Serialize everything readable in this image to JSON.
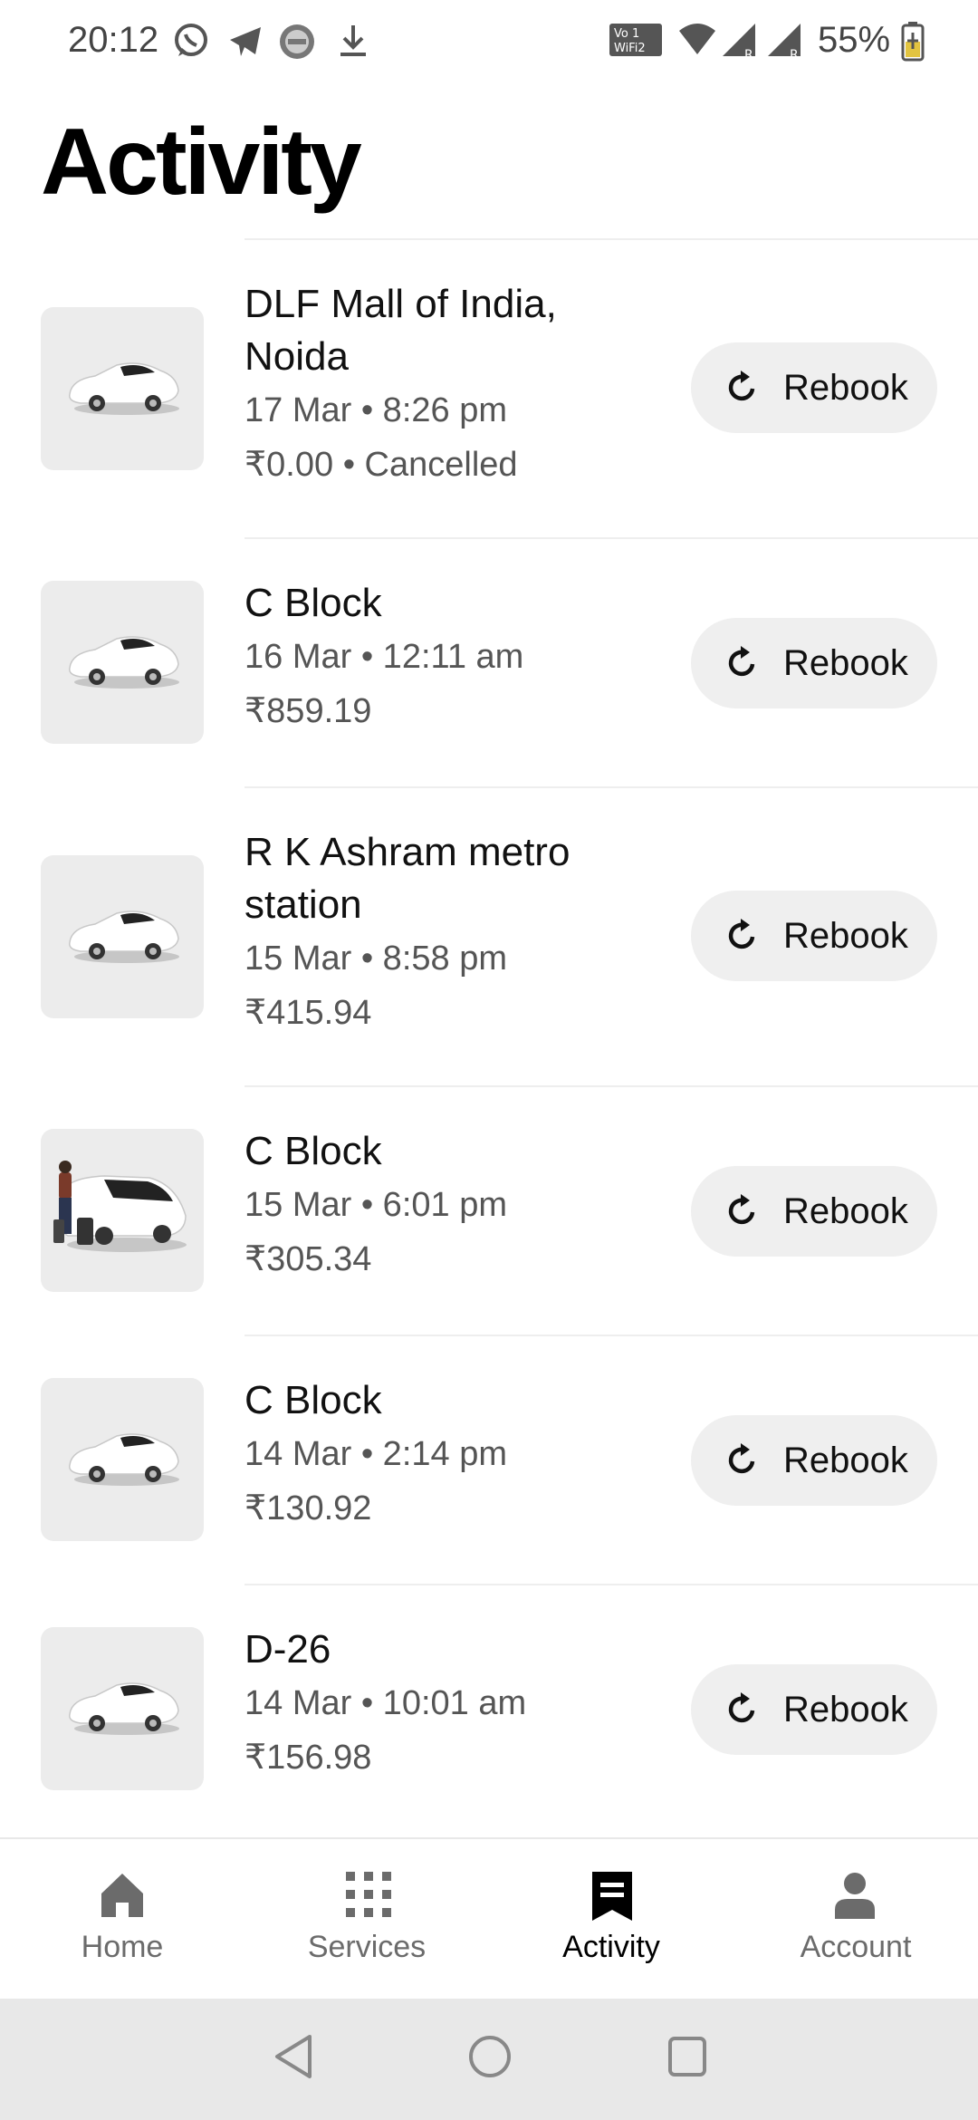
{
  "status_bar": {
    "time": "20:12",
    "battery_percent": "55%",
    "left_icons": [
      "whatsapp-icon",
      "telegram-icon",
      "app-badge-icon",
      "download-icon"
    ],
    "right_icons": [
      "vowifi-icon",
      "wifi-icon",
      "signal-r-icon",
      "signal-r-icon",
      "battery-charging-icon"
    ]
  },
  "page": {
    "title": "Activity"
  },
  "rebook_label": "Rebook",
  "rides": [
    {
      "place": "DLF Mall of India, Noida",
      "datetime": "17 Mar • 8:26 pm",
      "fare": "₹0.00 • Cancelled",
      "image": "car"
    },
    {
      "place": "C Block",
      "datetime": "16 Mar • 12:11 am",
      "fare": "₹859.19",
      "image": "car"
    },
    {
      "place": "R K Ashram metro station",
      "datetime": "15 Mar • 8:58 pm",
      "fare": "₹415.94",
      "image": "car"
    },
    {
      "place": "C Block",
      "datetime": "15 Mar • 6:01 pm",
      "fare": "₹305.34",
      "image": "van-with-passenger"
    },
    {
      "place": "C Block",
      "datetime": "14 Mar • 2:14 pm",
      "fare": "₹130.92",
      "image": "car"
    },
    {
      "place": "D-26",
      "datetime": "14 Mar • 10:01 am",
      "fare": "₹156.98",
      "image": "car"
    }
  ],
  "bottom_nav": {
    "items": [
      {
        "label": "Home",
        "icon": "home-icon",
        "active": false
      },
      {
        "label": "Services",
        "icon": "grid-icon",
        "active": false
      },
      {
        "label": "Activity",
        "icon": "receipt-icon",
        "active": true
      },
      {
        "label": "Account",
        "icon": "person-icon",
        "active": false
      }
    ]
  },
  "colors": {
    "accent": "#000000",
    "inactive": "#6b6b6b",
    "chip_bg": "#efefef",
    "thumb_bg": "#ececec"
  }
}
